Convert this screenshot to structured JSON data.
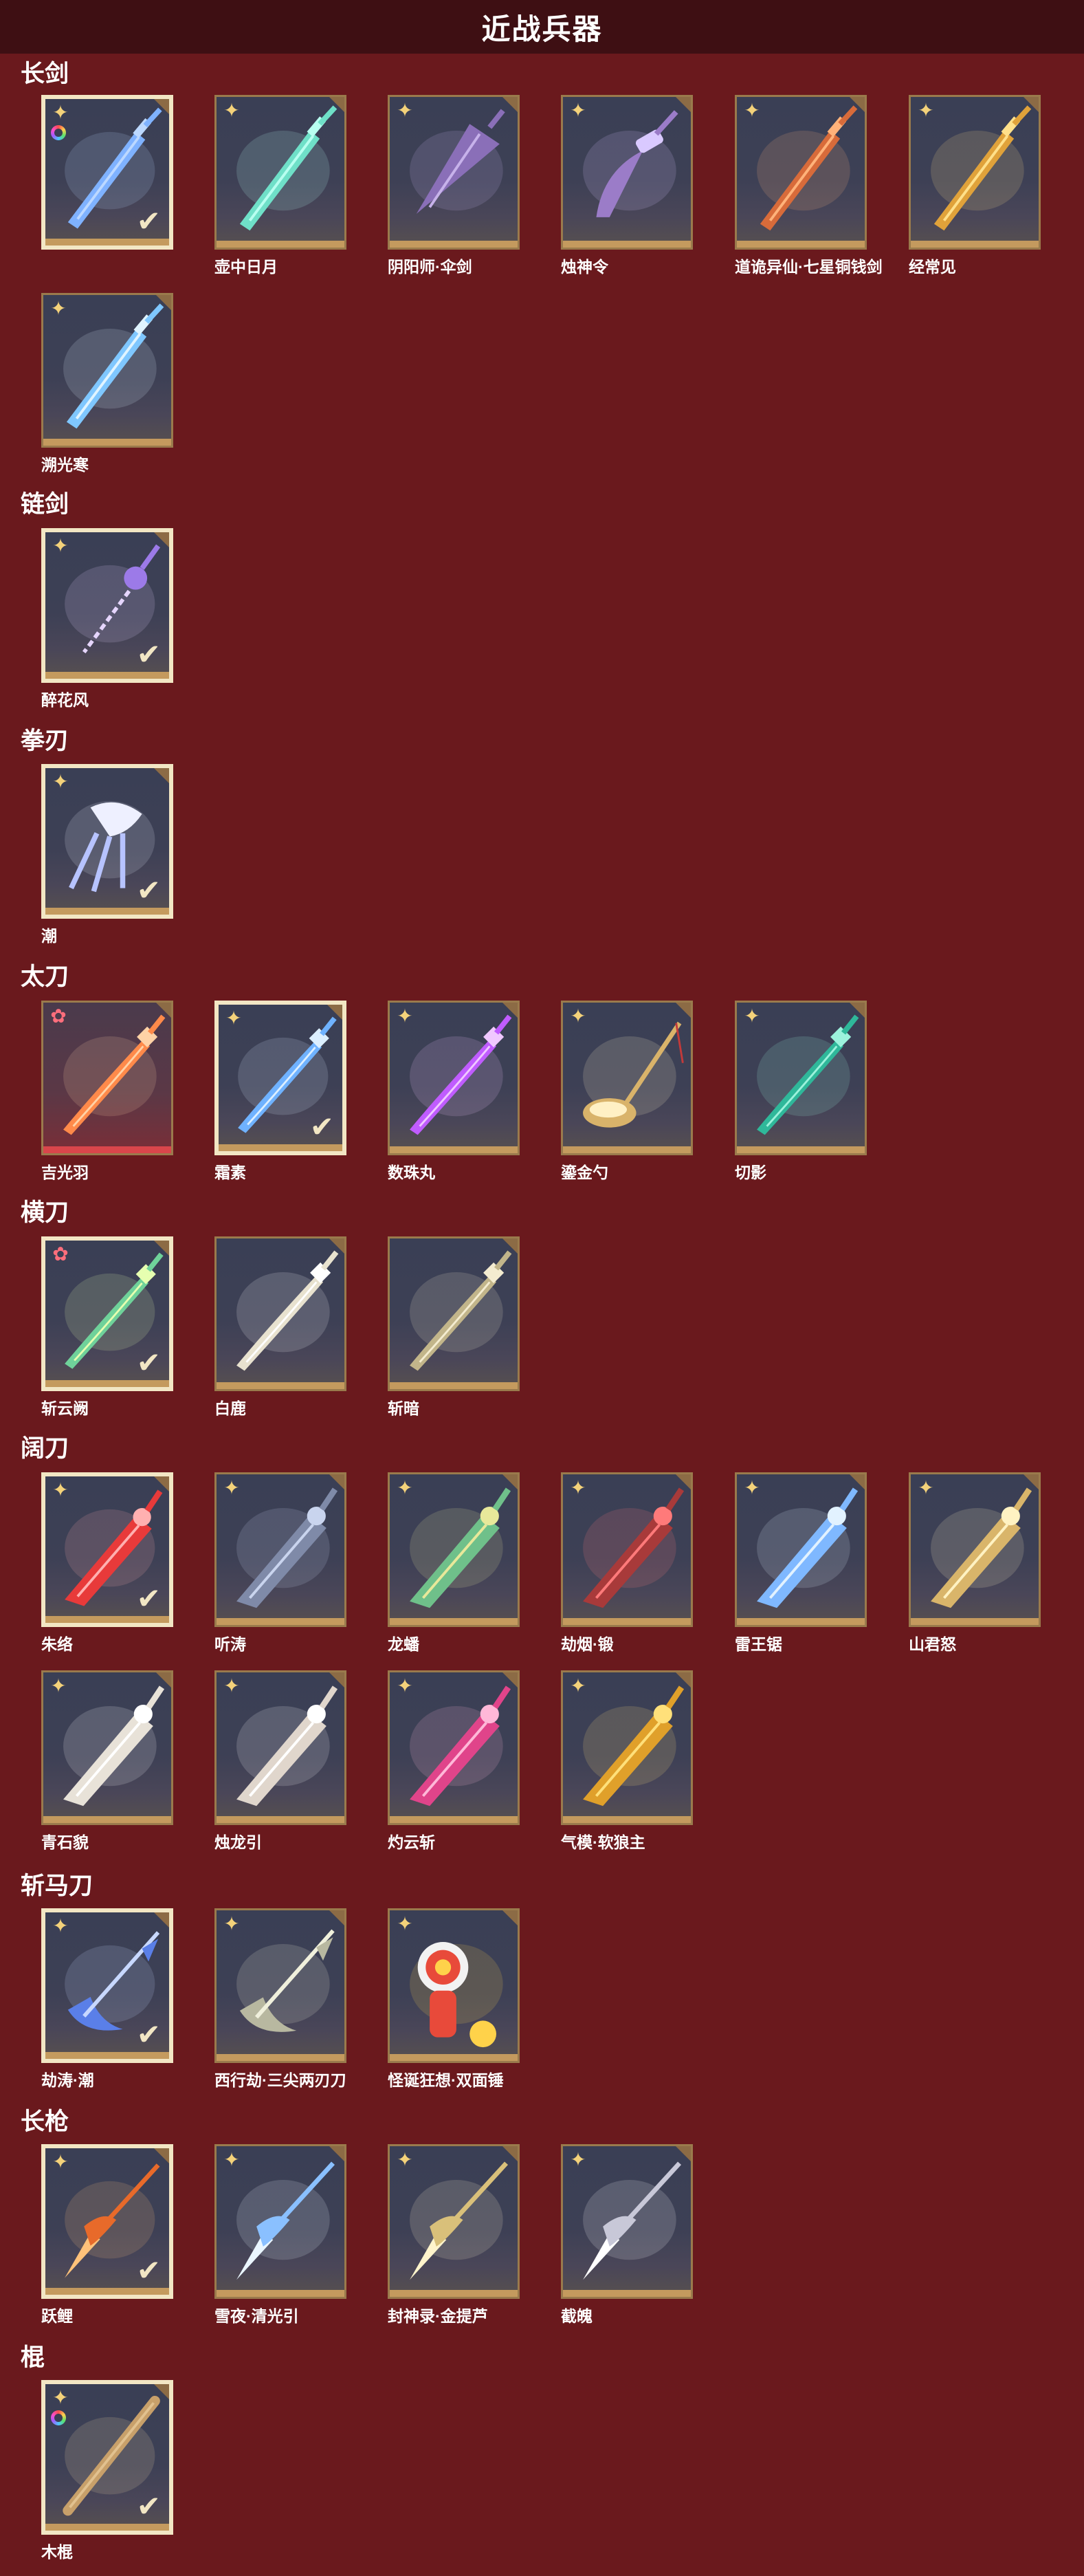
{
  "header": {
    "title": "近战兵器"
  },
  "colors": {
    "background": "#6a191d",
    "header": "#3e0f13",
    "gold_border": "#9a7a4c",
    "selected_border": "#f2e6c4"
  },
  "sections": [
    {
      "label": "长剑",
      "items": [
        {
          "name": "",
          "badge": "star-ring",
          "selected": true,
          "art": {
            "color": "#7fb2ff",
            "glow": "#bcd8ff",
            "shape": "sword"
          }
        },
        {
          "name": "壶中日月",
          "badge": "star",
          "selected": false,
          "art": {
            "color": "#6fe0c8",
            "glow": "#b8fff0",
            "shape": "sword"
          }
        },
        {
          "name": "阴阳师·伞剑",
          "badge": "star",
          "selected": false,
          "art": {
            "color": "#8a6fb8",
            "glow": "#c7b2ea",
            "shape": "umbrella"
          }
        },
        {
          "name": "烛神令",
          "badge": "star",
          "selected": false,
          "art": {
            "color": "#9b7cc8",
            "glow": "#d9c9ff",
            "shape": "curved"
          }
        },
        {
          "name": "道诡异仙·七星铜钱剑",
          "badge": "star",
          "selected": false,
          "art": {
            "color": "#d86b3a",
            "glow": "#ffb27a",
            "shape": "sword"
          }
        },
        {
          "name": "经常见",
          "badge": "star",
          "selected": false,
          "art": {
            "color": "#e0a23a",
            "glow": "#ffe08a",
            "shape": "sword"
          }
        },
        {
          "name": "溯光寒",
          "badge": "star",
          "selected": false,
          "art": {
            "color": "#7fc7ff",
            "glow": "#e0f4ff",
            "shape": "sword"
          }
        }
      ]
    },
    {
      "label": "链剑",
      "items": [
        {
          "name": "醉花风",
          "badge": "star",
          "selected": true,
          "art": {
            "color": "#9c7ae8",
            "glow": "#e6d6ff",
            "shape": "chain"
          }
        }
      ]
    },
    {
      "label": "拳刃",
      "items": [
        {
          "name": "潮",
          "badge": "star",
          "selected": true,
          "art": {
            "color": "#b7c3ff",
            "glow": "#eef0ff",
            "shape": "claw"
          }
        }
      ]
    },
    {
      "label": "太刀",
      "items": [
        {
          "name": "吉光羽",
          "badge": "star-red",
          "selected": false,
          "rarity": "red",
          "art": {
            "color": "#ff8a4a",
            "glow": "#ffd2a6",
            "shape": "katana"
          }
        },
        {
          "name": "霜素",
          "badge": "star",
          "selected": true,
          "art": {
            "color": "#6fb2ff",
            "glow": "#dcefff",
            "shape": "katana"
          }
        },
        {
          "name": "数珠丸",
          "badge": "star",
          "selected": false,
          "art": {
            "color": "#c05cff",
            "glow": "#f0c8ff",
            "shape": "katana"
          }
        },
        {
          "name": "鎏金勺",
          "badge": "star",
          "selected": false,
          "art": {
            "color": "#d9b36a",
            "glow": "#fff0c4",
            "shape": "spoon"
          }
        },
        {
          "name": "切影",
          "badge": "star",
          "selected": false,
          "art": {
            "color": "#2fb89a",
            "glow": "#9cf2dc",
            "shape": "katana"
          }
        }
      ]
    },
    {
      "label": "横刀",
      "items": [
        {
          "name": "斩云阙",
          "badge": "star-red",
          "selected": true,
          "art": {
            "color": "#6fd29a",
            "glow": "#e6ffb0",
            "shape": "katana"
          }
        },
        {
          "name": "白鹿",
          "badge": "",
          "selected": false,
          "art": {
            "color": "#e8e2cf",
            "glow": "#ffffff",
            "shape": "katana"
          }
        },
        {
          "name": "斩暗",
          "badge": "",
          "selected": false,
          "art": {
            "color": "#c2b58a",
            "glow": "#f4ecd0",
            "shape": "katana"
          }
        }
      ]
    },
    {
      "label": "阔刀",
      "items": [
        {
          "name": "朱络",
          "badge": "star",
          "selected": true,
          "art": {
            "color": "#e83a3a",
            "glow": "#ffb0b0",
            "shape": "broad"
          }
        },
        {
          "name": "听涛",
          "badge": "star",
          "selected": false,
          "art": {
            "color": "#7f8aa8",
            "glow": "#c9d4ee",
            "shape": "broad"
          }
        },
        {
          "name": "龙蟠",
          "badge": "star",
          "selected": false,
          "art": {
            "color": "#6fc08a",
            "glow": "#e8e89a",
            "shape": "broad"
          }
        },
        {
          "name": "劫烟·锻",
          "badge": "star",
          "selected": false,
          "art": {
            "color": "#a83a3a",
            "glow": "#ff7a7a",
            "shape": "broad"
          }
        },
        {
          "name": "雷王锯",
          "badge": "star",
          "selected": false,
          "art": {
            "color": "#7fb8ff",
            "glow": "#e2f2ff",
            "shape": "broad"
          }
        },
        {
          "name": "山君怒",
          "badge": "star",
          "selected": false,
          "art": {
            "color": "#d9b56a",
            "glow": "#fff2c2",
            "shape": "broad"
          }
        },
        {
          "name": "青石貌",
          "badge": "star",
          "selected": false,
          "art": {
            "color": "#e8e2d8",
            "glow": "#ffffff",
            "shape": "broad"
          }
        },
        {
          "name": "烛龙引",
          "badge": "star",
          "selected": false,
          "art": {
            "color": "#e0d6cc",
            "glow": "#ffffff",
            "shape": "broad"
          }
        },
        {
          "name": "灼云斩",
          "badge": "star",
          "selected": false,
          "art": {
            "color": "#e0448a",
            "glow": "#ffb8d8",
            "shape": "broad"
          }
        },
        {
          "name": "气模·软狼主",
          "badge": "star",
          "selected": false,
          "art": {
            "color": "#e0a02a",
            "glow": "#ffe07a",
            "shape": "broad"
          }
        }
      ]
    },
    {
      "label": "斩马刀",
      "items": [
        {
          "name": "劫涛·潮",
          "badge": "star",
          "selected": true,
          "art": {
            "color": "#5a7fe8",
            "glow": "#c8d8ff",
            "shape": "halberd"
          }
        },
        {
          "name": "西行劫·三尖两刃刀",
          "badge": "star",
          "selected": false,
          "art": {
            "color": "#b8b8a0",
            "glow": "#f0f0dc",
            "shape": "halberd"
          }
        },
        {
          "name": "怪诞狂想·双面锤",
          "badge": "star",
          "selected": false,
          "art": {
            "color": "#e84a3a",
            "glow": "#ffd24a",
            "shape": "hammer"
          }
        }
      ]
    },
    {
      "label": "长枪",
      "items": [
        {
          "name": "跃鲤",
          "badge": "star",
          "selected": true,
          "art": {
            "color": "#e86a2a",
            "glow": "#ffc27a",
            "shape": "spear"
          }
        },
        {
          "name": "雪夜·清光引",
          "badge": "star",
          "selected": false,
          "art": {
            "color": "#8ac0ff",
            "glow": "#eaf6ff",
            "shape": "spear"
          }
        },
        {
          "name": "封神录·金提芦",
          "badge": "star",
          "selected": false,
          "art": {
            "color": "#d9c07a",
            "glow": "#fff4cc",
            "shape": "spear"
          }
        },
        {
          "name": "截魄",
          "badge": "star",
          "selected": false,
          "art": {
            "color": "#c8c8d8",
            "glow": "#ffffff",
            "shape": "spear"
          }
        }
      ]
    },
    {
      "label": "棍",
      "items": [
        {
          "name": "木棍",
          "badge": "star-ring",
          "selected": true,
          "art": {
            "color": "#c8a06a",
            "glow": "#f2d8a8",
            "shape": "staff"
          }
        }
      ]
    }
  ]
}
